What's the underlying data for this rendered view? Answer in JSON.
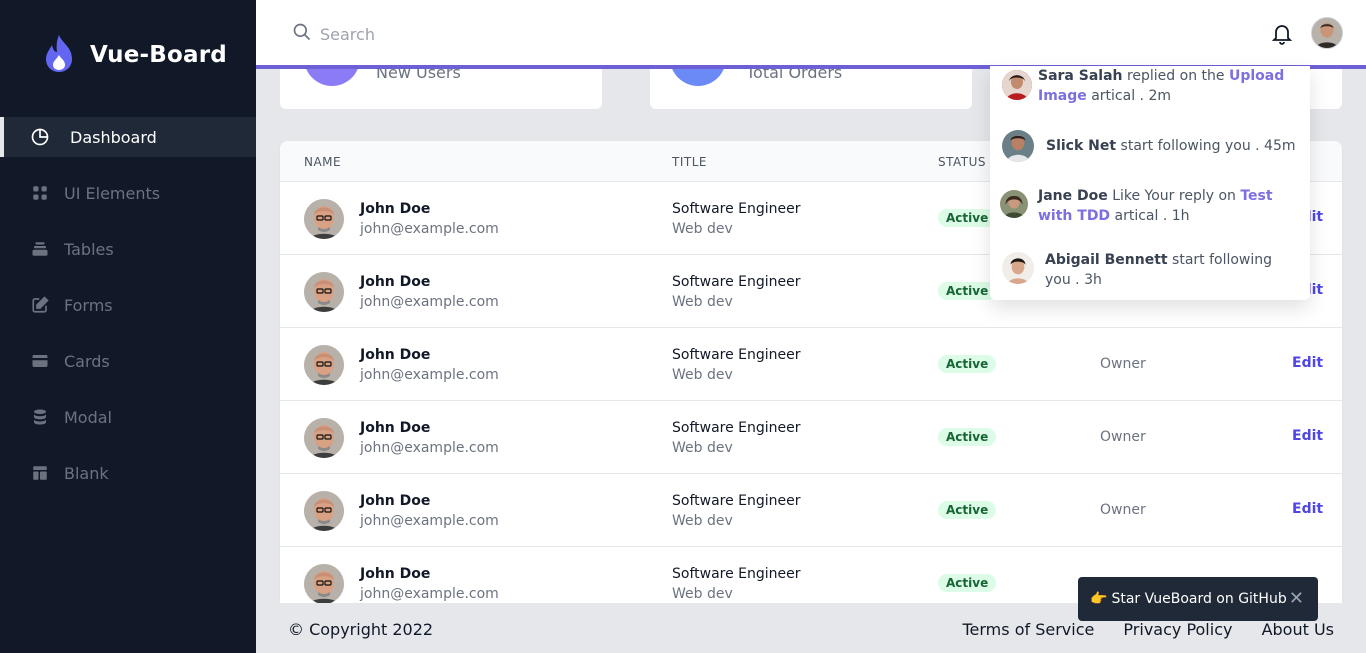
{
  "sidebar": {
    "brand": "Vue-Board",
    "items": [
      {
        "label": "Dashboard",
        "icon": "pie-chart-icon",
        "active": true
      },
      {
        "label": "UI Elements",
        "icon": "grid-icon"
      },
      {
        "label": "Tables",
        "icon": "stack-icon"
      },
      {
        "label": "Forms",
        "icon": "edit-icon"
      },
      {
        "label": "Cards",
        "icon": "card-icon"
      },
      {
        "label": "Modal",
        "icon": "database-icon"
      },
      {
        "label": "Blank",
        "icon": "layout-icon"
      }
    ]
  },
  "header": {
    "search_placeholder": "Search"
  },
  "stats": [
    {
      "label": "New Users",
      "color": "#8b7cf6"
    },
    {
      "label": "Total Orders",
      "color": "#6b8af6"
    }
  ],
  "table": {
    "headers": [
      "NAME",
      "TITLE",
      "STATUS"
    ],
    "rows": [
      {
        "name": "John Doe",
        "email": "john@example.com",
        "title": "Software Engineer",
        "dept": "Web dev",
        "status": "Active",
        "role": "",
        "action": "Edit"
      },
      {
        "name": "John Doe",
        "email": "john@example.com",
        "title": "Software Engineer",
        "dept": "Web dev",
        "status": "Active",
        "role": "",
        "action": "Edit"
      },
      {
        "name": "John Doe",
        "email": "john@example.com",
        "title": "Software Engineer",
        "dept": "Web dev",
        "status": "Active",
        "role": "Owner",
        "action": "Edit"
      },
      {
        "name": "John Doe",
        "email": "john@example.com",
        "title": "Software Engineer",
        "dept": "Web dev",
        "status": "Active",
        "role": "Owner",
        "action": "Edit"
      },
      {
        "name": "John Doe",
        "email": "john@example.com",
        "title": "Software Engineer",
        "dept": "Web dev",
        "status": "Active",
        "role": "Owner",
        "action": "Edit"
      },
      {
        "name": "John Doe",
        "email": "john@example.com",
        "title": "Software Engineer",
        "dept": "Web dev",
        "status": "Active",
        "role": "",
        "action": ""
      }
    ]
  },
  "notifications": [
    {
      "user": "Sara Salah",
      "pre": "replied on the",
      "link": "Upload Image",
      "post": "artical . 2m"
    },
    {
      "user": "Slick Net",
      "pre": "start following you . 45m",
      "link": "",
      "post": ""
    },
    {
      "user": "Jane Doe",
      "pre": "Like Your reply on",
      "link": "Test with TDD",
      "post": "artical . 1h"
    },
    {
      "user": "Abigail Bennett",
      "pre": "start following you . 3h",
      "link": "",
      "post": ""
    }
  ],
  "footer": {
    "copyright": "© Copyright 2022",
    "links": [
      "Terms of Service",
      "Privacy Policy",
      "About Us"
    ]
  },
  "toast": {
    "emoji": "👉",
    "text": "Star VueBoard on GitHub",
    "close": "✕"
  },
  "colors": {
    "sidebar_bg": "#111827",
    "accent": "#6d5fd6",
    "link": "#4f46e5",
    "status_bg": "#dcfce7",
    "status_text": "#166534"
  }
}
